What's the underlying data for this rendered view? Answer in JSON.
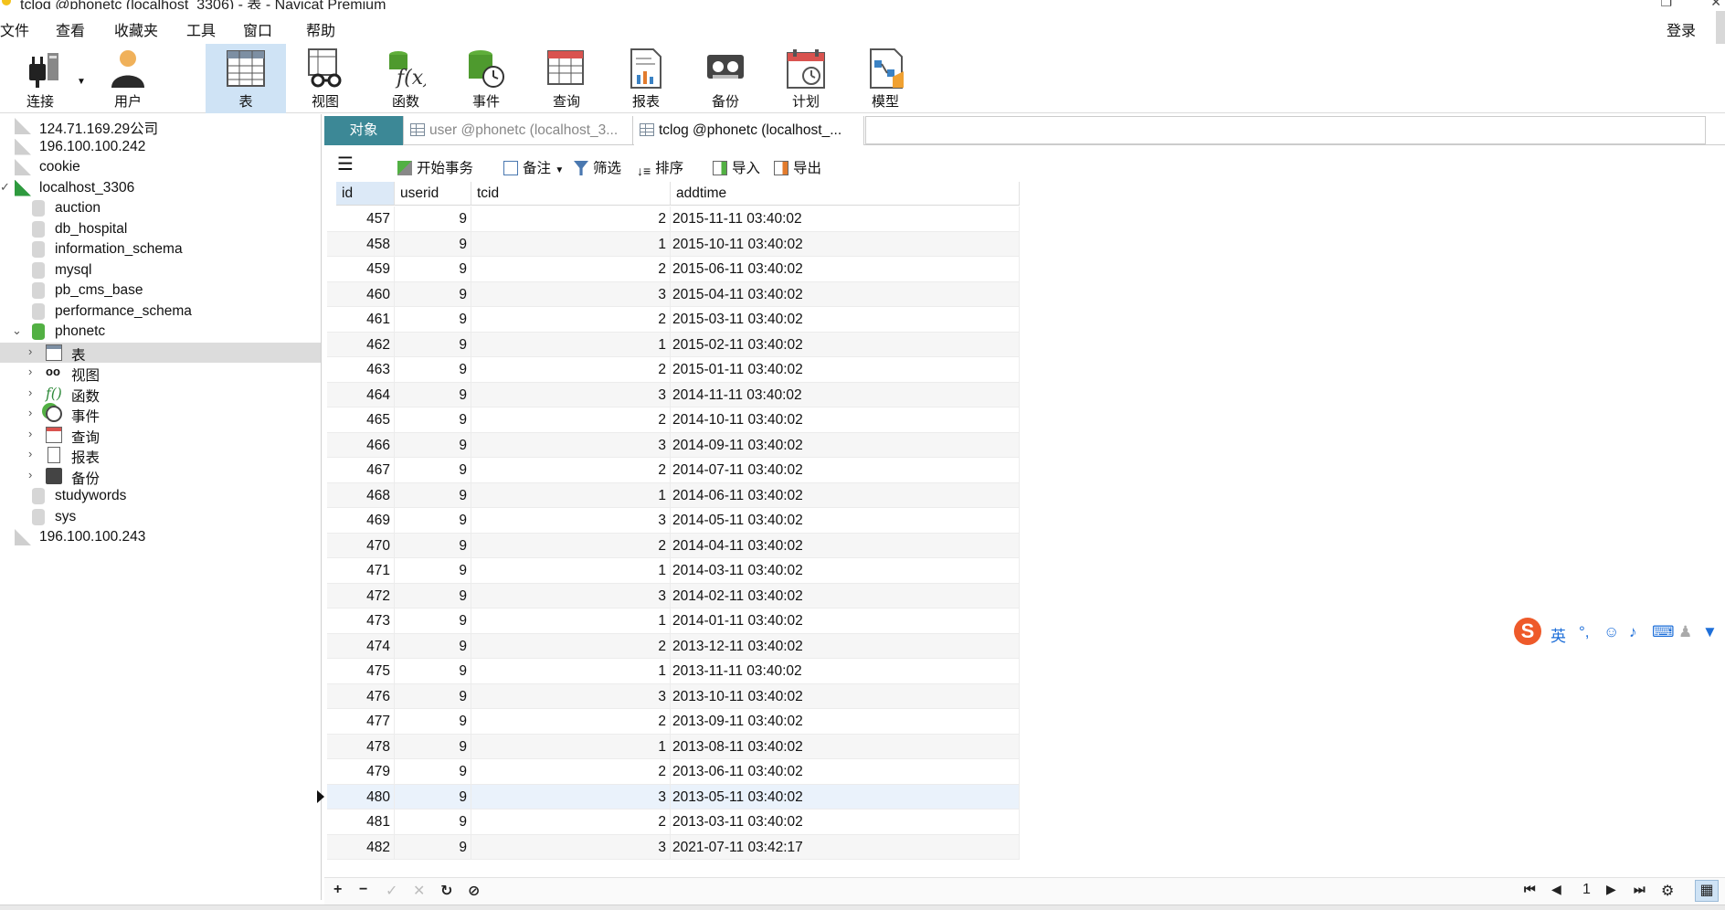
{
  "window": {
    "title": "tclog @phonetc (localhost_3306) - 表 - Navicat Premium"
  },
  "menu": {
    "items": [
      "文件",
      "查看",
      "收藏夹",
      "工具",
      "窗口",
      "帮助"
    ],
    "login": "登录"
  },
  "toolbar": {
    "connect": "连接",
    "user": "用户",
    "table": "表",
    "view": "视图",
    "function": "函数",
    "event": "事件",
    "query": "查询",
    "report": "报表",
    "backup": "备份",
    "schedule": "计划",
    "model": "模型"
  },
  "sidebar": {
    "items": [
      {
        "label": "124.71.169.29公司"
      },
      {
        "label": "196.100.100.242"
      },
      {
        "label": "cookie"
      },
      {
        "label": "localhost_3306"
      },
      {
        "label": "auction"
      },
      {
        "label": "db_hospital"
      },
      {
        "label": "information_schema"
      },
      {
        "label": "mysql"
      },
      {
        "label": "pb_cms_base"
      },
      {
        "label": "performance_schema"
      },
      {
        "label": "phonetc"
      },
      {
        "label": "表"
      },
      {
        "label": "视图"
      },
      {
        "label": "函数"
      },
      {
        "label": "事件"
      },
      {
        "label": "查询"
      },
      {
        "label": "报表"
      },
      {
        "label": "备份"
      },
      {
        "label": "studywords"
      },
      {
        "label": "sys"
      },
      {
        "label": "196.100.100.243"
      }
    ]
  },
  "tabs": {
    "objects": "对象",
    "user": "user @phonetc (localhost_3...",
    "tclog": "tclog @phonetc (localhost_..."
  },
  "table_toolbar": {
    "begin_transaction": "开始事务",
    "note": "备注",
    "filter": "筛选",
    "sort": "排序",
    "import": "导入",
    "export": "导出"
  },
  "grid": {
    "columns": [
      "id",
      "userid",
      "tcid",
      "addtime"
    ],
    "rows": [
      [
        "457",
        "9",
        "2",
        "2015-11-11 03:40:02"
      ],
      [
        "458",
        "9",
        "1",
        "2015-10-11 03:40:02"
      ],
      [
        "459",
        "9",
        "2",
        "2015-06-11 03:40:02"
      ],
      [
        "460",
        "9",
        "3",
        "2015-04-11 03:40:02"
      ],
      [
        "461",
        "9",
        "2",
        "2015-03-11 03:40:02"
      ],
      [
        "462",
        "9",
        "1",
        "2015-02-11 03:40:02"
      ],
      [
        "463",
        "9",
        "2",
        "2015-01-11 03:40:02"
      ],
      [
        "464",
        "9",
        "3",
        "2014-11-11 03:40:02"
      ],
      [
        "465",
        "9",
        "2",
        "2014-10-11 03:40:02"
      ],
      [
        "466",
        "9",
        "3",
        "2014-09-11 03:40:02"
      ],
      [
        "467",
        "9",
        "2",
        "2014-07-11 03:40:02"
      ],
      [
        "468",
        "9",
        "1",
        "2014-06-11 03:40:02"
      ],
      [
        "469",
        "9",
        "3",
        "2014-05-11 03:40:02"
      ],
      [
        "470",
        "9",
        "2",
        "2014-04-11 03:40:02"
      ],
      [
        "471",
        "9",
        "1",
        "2014-03-11 03:40:02"
      ],
      [
        "472",
        "9",
        "3",
        "2014-02-11 03:40:02"
      ],
      [
        "473",
        "9",
        "1",
        "2014-01-11 03:40:02"
      ],
      [
        "474",
        "9",
        "2",
        "2013-12-11 03:40:02"
      ],
      [
        "475",
        "9",
        "1",
        "2013-11-11 03:40:02"
      ],
      [
        "476",
        "9",
        "3",
        "2013-10-11 03:40:02"
      ],
      [
        "477",
        "9",
        "2",
        "2013-09-11 03:40:02"
      ],
      [
        "478",
        "9",
        "1",
        "2013-08-11 03:40:02"
      ],
      [
        "479",
        "9",
        "2",
        "2013-06-11 03:40:02"
      ],
      [
        "480",
        "9",
        "3",
        "2013-05-11 03:40:02"
      ],
      [
        "481",
        "9",
        "2",
        "2013-03-11 03:40:02"
      ],
      [
        "482",
        "9",
        "3",
        "2021-07-11 03:42:17"
      ]
    ],
    "current_row_index": 23
  },
  "ime": {
    "lang": "英"
  },
  "pagination": {
    "page": "1"
  },
  "colors": {
    "accent_tab": "#3c8896",
    "active_tool": "#cfe3f5",
    "selected_tree": "#dcdcdc"
  }
}
